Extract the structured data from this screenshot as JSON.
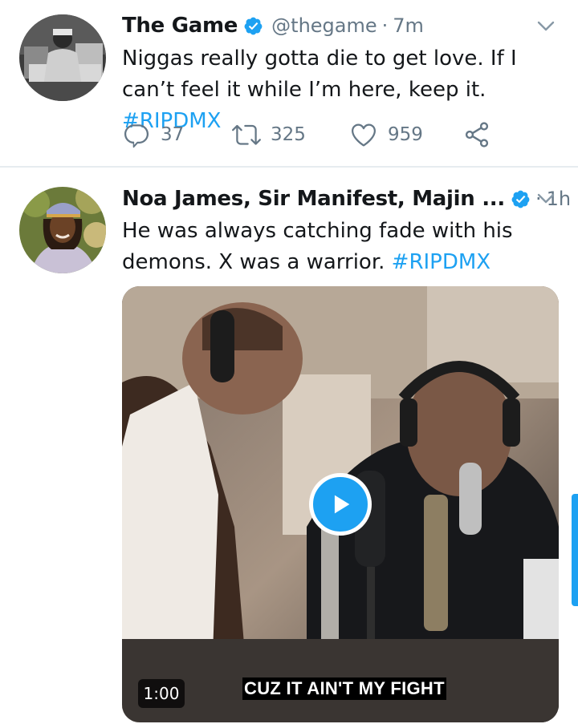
{
  "tweets": [
    {
      "name": "The Game",
      "handle": "@thegame",
      "time": "7m",
      "text": "Niggas really gotta die to get love. If I can’t feel it while I’m here, keep it.",
      "hashtag": "#RIPDMX",
      "replies": "37",
      "retweets": "325",
      "likes": "959",
      "verified": true
    },
    {
      "name": "Noa James, Sir Manifest, Majin ...",
      "time": "1h",
      "text": "He was always catching fade with his demons. X was a warrior.",
      "hashtag": "#RIPDMX",
      "verified": true,
      "media": {
        "type": "video",
        "duration": "1:00",
        "caption": "CUZ IT AIN'T MY FIGHT"
      }
    }
  ],
  "icons": {
    "reply": "reply-icon",
    "retweet": "retweet-icon",
    "like": "heart-icon",
    "share": "share-icon",
    "more": "chevron-down-icon",
    "verified": "verified-badge-icon",
    "play": "play-icon"
  },
  "colors": {
    "accent": "#1da1f2",
    "secondary_text": "#657786",
    "divider": "#e6ecf0"
  }
}
